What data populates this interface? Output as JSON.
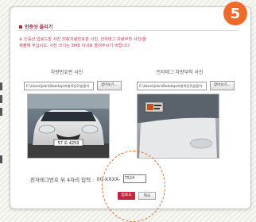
{
  "step_number": "5",
  "section_title": "인증샷 올리기",
  "notice_lines": [
    "※ 인증샷 업로드할 사진 3매(차량번호판 사진, 전자태그 차량부착 사진)을",
    "제출해 주십시오. 사진 크기는 3MB 이내로 올려주시기 바랍니다."
  ],
  "columns": [
    {
      "label": "차량번호판 사진",
      "file_path": "C:\\Users\\john\\Desktop\\하창하은2\\송용차",
      "browse_label": "찾아보기...",
      "plate_text": "57 오 4253"
    },
    {
      "label": "전자태그 차량부착 사진",
      "file_path": "C:\\Users\\john\\Desktop\\하창하은2\\송용차",
      "browse_label": "찾아보기..."
    }
  ],
  "code_entry": {
    "label": "전자태그번호 뒤 4자리 입력 :",
    "prefix": "00-XXXX-",
    "value": "7524"
  },
  "buttons": {
    "upload": "업로드",
    "cancel": "취소"
  },
  "colors": {
    "accent": "#ef6a2a",
    "brand": "#c4263f"
  }
}
